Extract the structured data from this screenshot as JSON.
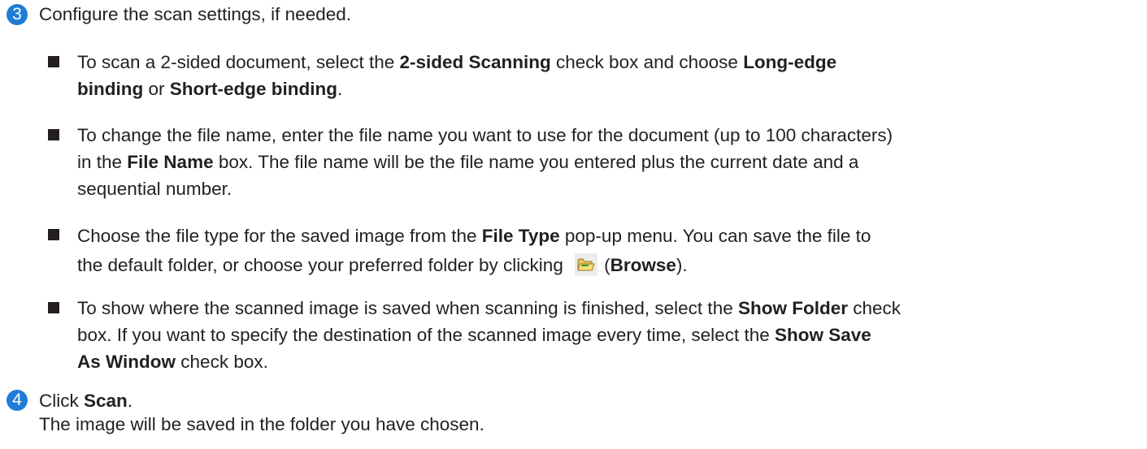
{
  "step3": {
    "number": "3",
    "text": "Configure the scan settings, if needed.",
    "bullets": [
      {
        "lines": [
          [
            {
              "t": "To scan a 2-sided document, select the "
            },
            {
              "t": "2-sided Scanning",
              "b": true
            },
            {
              "t": " check box and choose "
            },
            {
              "t": "Long-edge",
              "b": true
            }
          ],
          [
            {
              "t": "binding",
              "b": true
            },
            {
              "t": " or "
            },
            {
              "t": "Short-edge binding",
              "b": true
            },
            {
              "t": "."
            }
          ]
        ]
      },
      {
        "lines": [
          [
            {
              "t": "To change the file name, enter the file name you want to use for the document (up to 100 characters)"
            }
          ],
          [
            {
              "t": "in the "
            },
            {
              "t": "File Name",
              "b": true
            },
            {
              "t": " box. The file name will be the file name you entered plus the current date and a"
            }
          ],
          [
            {
              "t": "sequential number."
            }
          ]
        ]
      },
      {
        "lines": [
          [
            {
              "t": "Choose the file type for the saved image from the "
            },
            {
              "t": "File Type",
              "b": true
            },
            {
              "t": " pop-up menu. You can save the file to"
            }
          ],
          [
            {
              "t": "the default folder, or choose your preferred folder by clicking "
            },
            {
              "icon": "folder-browse-icon"
            },
            {
              "t": "("
            },
            {
              "t": "Browse",
              "b": true
            },
            {
              "t": ")."
            }
          ]
        ]
      },
      {
        "lines": [
          [
            {
              "t": "To show where the scanned image is saved when scanning is finished, select the "
            },
            {
              "t": "Show Folder",
              "b": true
            },
            {
              "t": " check"
            }
          ],
          [
            {
              "t": "box. If you want to specify the destination of the scanned image every time, select the "
            },
            {
              "t": "Show Save",
              "b": true
            }
          ],
          [
            {
              "t": "As Window",
              "b": true
            },
            {
              "t": " check box."
            }
          ]
        ]
      }
    ]
  },
  "step4": {
    "number": "4",
    "line1": [
      {
        "t": "Click "
      },
      {
        "t": "Scan",
        "b": true
      },
      {
        "t": "."
      }
    ],
    "line2": "The image will be saved in the folder you have chosen."
  },
  "colors": {
    "step_badge": "#1f7dd8",
    "text": "#231f20"
  }
}
